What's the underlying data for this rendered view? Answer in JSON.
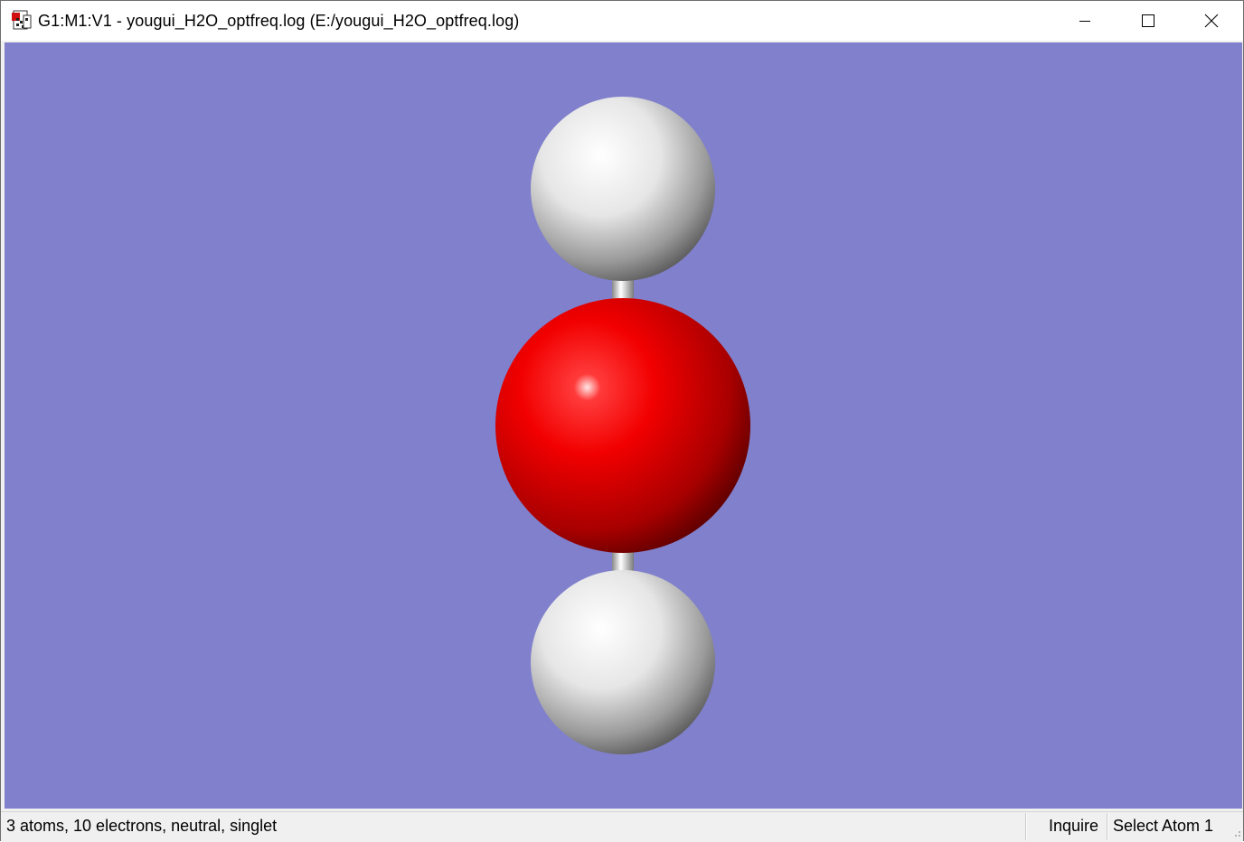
{
  "window": {
    "title": "G1:M1:V1 - yougui_H2O_optfreq.log (E:/yougui_H2O_optfreq.log)",
    "icon": "document-app-icon",
    "controls": {
      "minimize_icon": "minimize-icon",
      "maximize_icon": "maximize-icon",
      "close_icon": "close-icon"
    }
  },
  "viewer": {
    "background_color": "#8080cc",
    "atoms": [
      {
        "element": "H",
        "color": "#f2f2f2"
      },
      {
        "element": "O",
        "color": "#ff0000"
      },
      {
        "element": "H",
        "color": "#f2f2f2"
      }
    ],
    "bonds": [
      {
        "from": 0,
        "to": 1
      },
      {
        "from": 1,
        "to": 2
      }
    ]
  },
  "statusbar": {
    "info": "3 atoms, 10 electrons, neutral, singlet",
    "mode": "Inquire",
    "action": "Select Atom 1"
  }
}
